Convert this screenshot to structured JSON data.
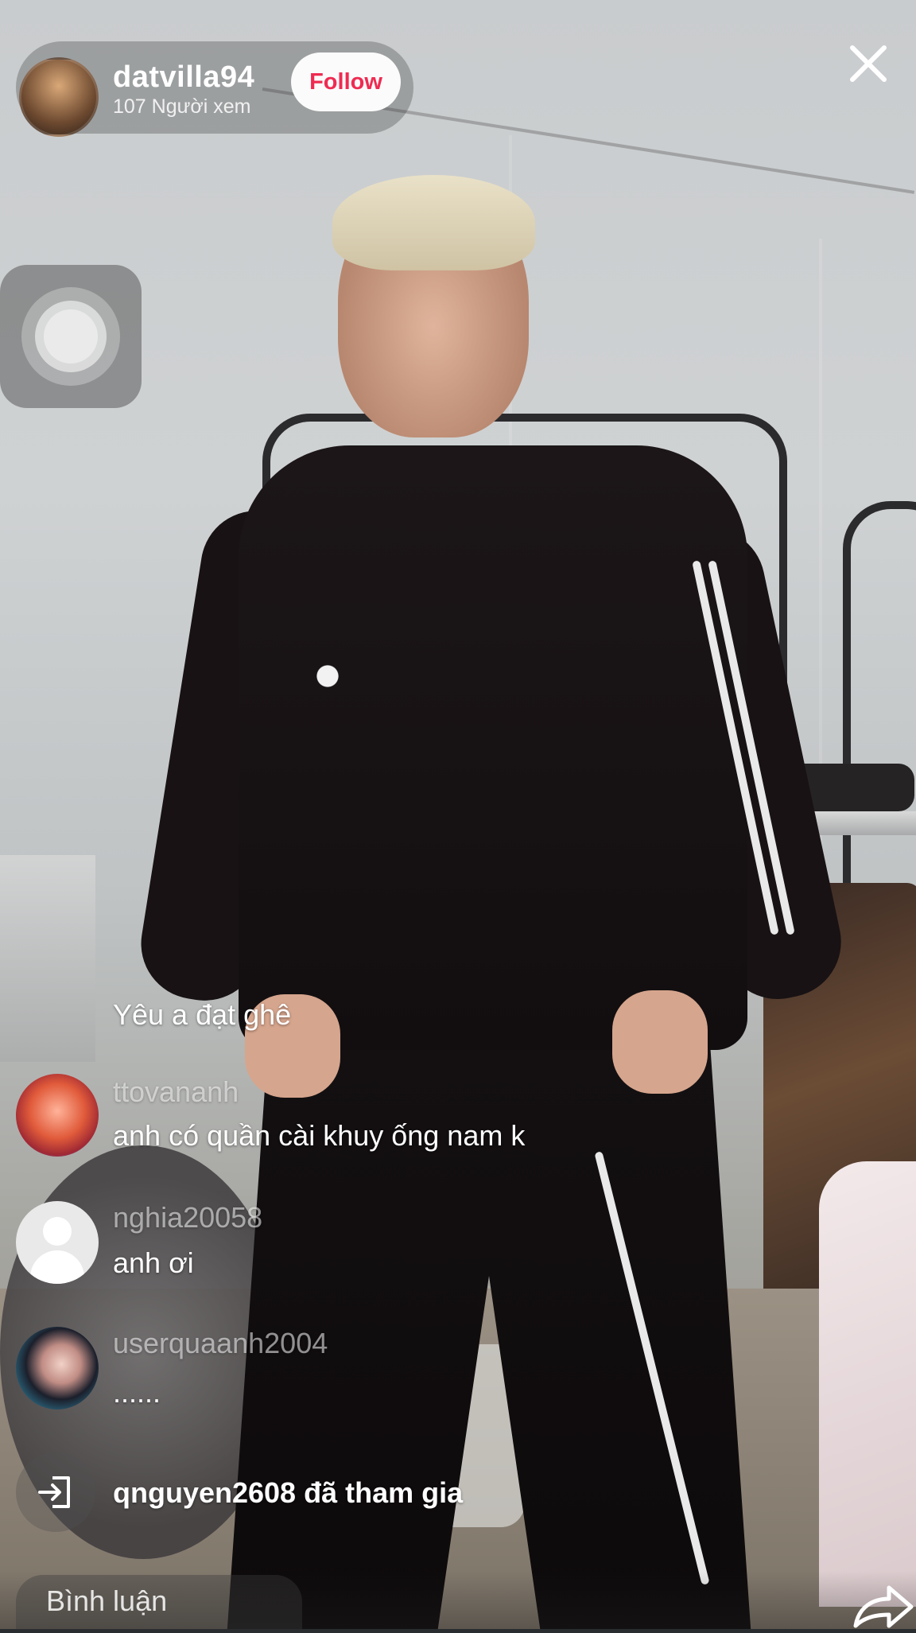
{
  "host": {
    "username": "datvilla94",
    "viewers": "107 Người xem",
    "follow_label": "Follow"
  },
  "comments": [
    {
      "user": "",
      "text": "Yêu a đạt ghê"
    },
    {
      "user": "ttovananh",
      "text": "anh có quần cài khuy ống nam k"
    },
    {
      "user": "nghia20058",
      "text": "anh ơi"
    },
    {
      "user": "userquaanh2004",
      "text": "......"
    }
  ],
  "join_notice": "qnguyen2608 đã tham gia",
  "comment_input": {
    "placeholder": "Bình luận"
  },
  "icons": {
    "close": "close-icon",
    "assistive_touch": "assistive-touch-icon",
    "join": "join-icon",
    "share": "share-icon"
  },
  "colors": {
    "follow_text": "#ef2b52",
    "follow_bg": "#fbfbfb"
  }
}
